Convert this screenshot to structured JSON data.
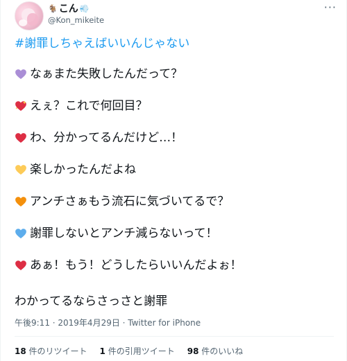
{
  "author": {
    "name": "こん",
    "name_emoji_1": "🐐",
    "name_emoji_2": "💨",
    "handle": "@Kon_mikeite"
  },
  "more_label": "···",
  "tweet": {
    "hashtag": "#謝罪しちゃえばいいんじゃない",
    "lines": [
      {
        "heart": "purple-heart",
        "color": "#aa8ed6",
        "text": "なぁまた失敗したんだって？"
      },
      {
        "heart": "sparkling-heart",
        "color": "#dd2e44",
        "text": "えぇ？これで何回目？"
      },
      {
        "heart": "red-heart",
        "color": "#dd2e44",
        "text": "わ、分かってるんだけど…！"
      },
      {
        "heart": "yellow-heart",
        "color": "#fdcb58",
        "text": "楽しかったんだよね"
      },
      {
        "heart": "orange-heart",
        "color": "#f4900c",
        "text": "アンチさぁもう流石に気づいてるで？"
      },
      {
        "heart": "blue-heart",
        "color": "#5dadec",
        "text": "謝罪しないとアンチ減らないって！"
      },
      {
        "heart": "red-heart",
        "color": "#dd2e44",
        "text": "あぁ！もう！どうしたらいいんだよぉ！"
      }
    ],
    "closing": "わかってるならさっさと謝罪"
  },
  "meta": "午後9:11 · 2019年4月29日 · Twitter for iPhone",
  "stats": {
    "retweets_count": "18",
    "retweets_label": "件のリツイート",
    "quotes_count": "1",
    "quotes_label": "件の引用ツイート",
    "likes_count": "98",
    "likes_label": "件のいいね"
  }
}
